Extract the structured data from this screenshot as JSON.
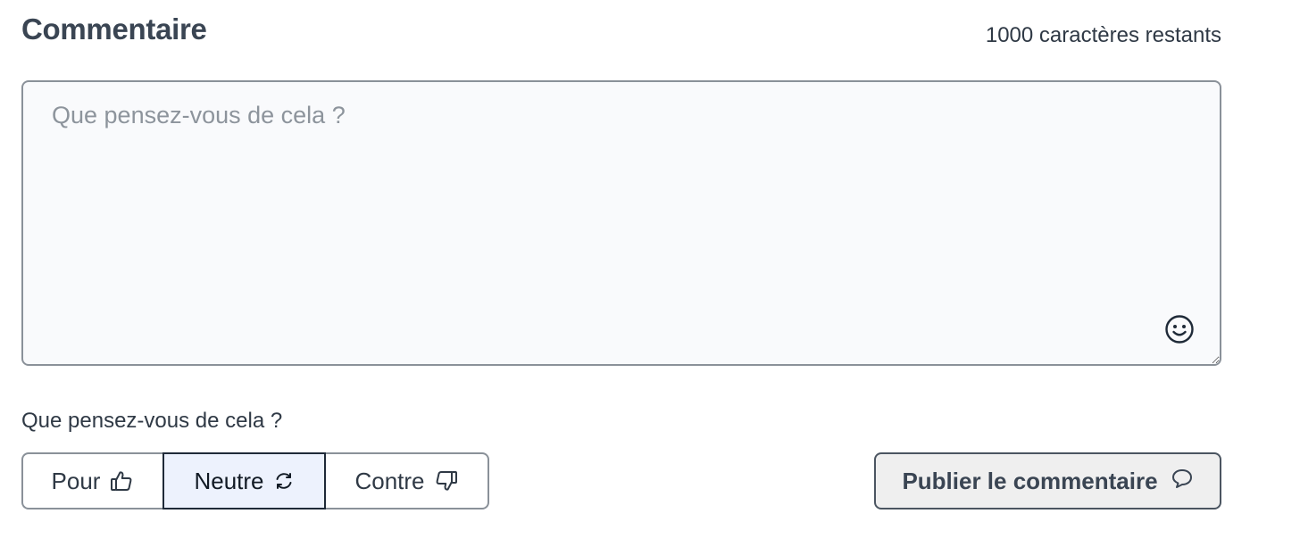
{
  "header": {
    "title": "Commentaire",
    "remaining": "1000 caractères restants"
  },
  "comment": {
    "placeholder": "Que pensez-vous de cela ?",
    "value": "",
    "emoji_icon": "smiley-icon"
  },
  "opinion": {
    "question": "Que pensez-vous de cela ?",
    "options": [
      {
        "label": "Pour",
        "icon": "thumbs-up-icon",
        "selected": false
      },
      {
        "label": "Neutre",
        "icon": "circle-arrows-icon",
        "selected": true
      },
      {
        "label": "Contre",
        "icon": "thumbs-down-icon",
        "selected": false
      }
    ]
  },
  "actions": {
    "publish_label": "Publier le commentaire",
    "publish_icon": "speech-bubble-icon"
  },
  "colors": {
    "text": "#2f3945",
    "border": "#8a9199",
    "selected_bg": "#edf2fd",
    "textarea_bg": "#f9fafc",
    "button_bg": "#efefef"
  }
}
